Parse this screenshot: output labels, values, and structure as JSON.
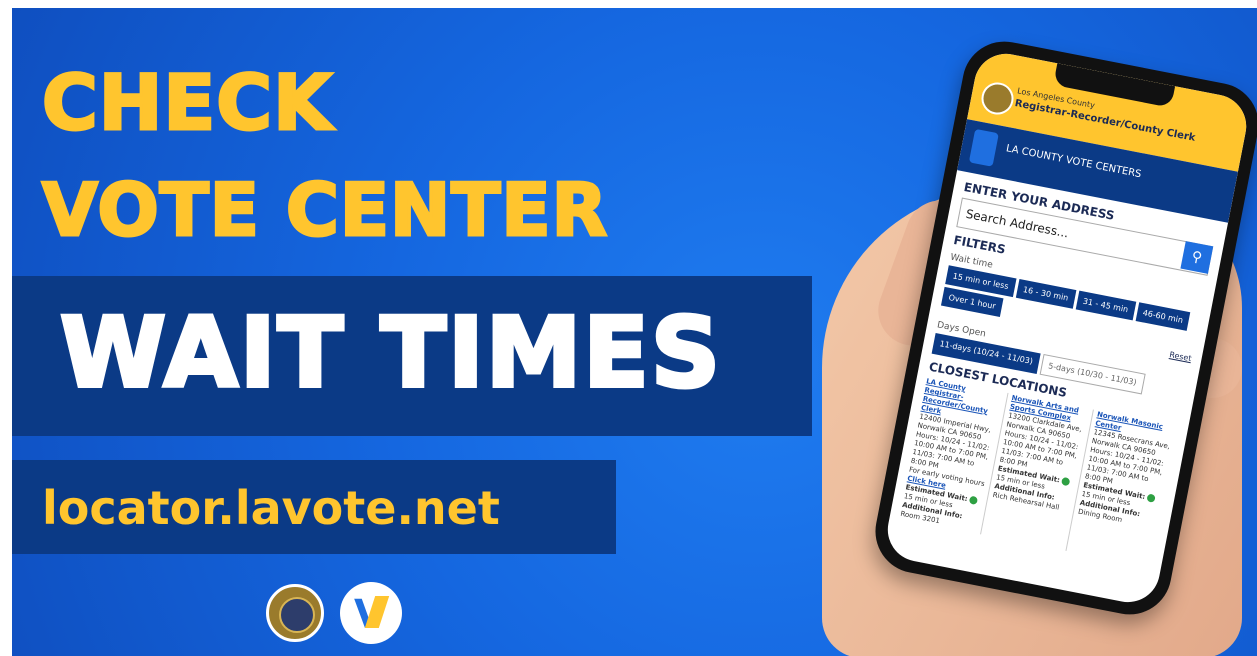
{
  "headline": {
    "line1": "CHECK",
    "line2": "VOTE CENTER",
    "line3": "WAIT TIMES",
    "url": "locator.lavote.net"
  },
  "colors": {
    "background": "#1567e0",
    "navy_band": "#0b3a86",
    "accent_yellow": "#ffc52e",
    "white": "#ffffff"
  },
  "logos": {
    "seal": "county-seal-icon",
    "vote_logo": "v-logo-icon"
  },
  "phone": {
    "header_line1": "Los Angeles County",
    "header_line2": "Registrar-Recorder/County Clerk",
    "nav_title": "LA COUNTY VOTE CENTERS",
    "enter_address": "ENTER YOUR ADDRESS",
    "search_placeholder": "Search Address...",
    "filters_title": "FILTERS",
    "wait_time_label": "Wait time",
    "wait_chips": [
      "15 min or less",
      "16 - 30 min",
      "31 - 45 min",
      "46-60 min",
      "Over 1 hour"
    ],
    "reset": "Reset",
    "days_open_label": "Days Open",
    "days_chips": [
      "11-days (10/24 - 11/03)",
      "5-days (10/30 - 11/03)"
    ],
    "closest_title": "CLOSEST LOCATIONS",
    "locations": [
      {
        "name": "LA County Registrar-Recorder/County Clerk",
        "address": "12400 Imperial Hwy, Norwalk CA 90650",
        "hours": "Hours: 10/24 - 11/02: 10:00 AM to 7:00 PM, 11/03: 7:00 AM to 8:00 PM",
        "extra": "For early voting hours",
        "link": "Click here",
        "wait_label": "Estimated Wait:",
        "wait": "15 min or less",
        "info_label": "Additional Info:",
        "info": "Room 3201"
      },
      {
        "name": "Norwalk Arts and Sports Complex",
        "address": "13200 Clarkdale Ave, Norwalk CA 90650",
        "hours": "Hours: 10/24 - 11/02: 10:00 AM to 7:00 PM, 11/03: 7:00 AM to 8:00 PM",
        "wait_label": "Estimated Wait:",
        "wait": "15 min or less",
        "info_label": "Additional Info:",
        "info": "Rich Rehearsal Hall"
      },
      {
        "name": "Norwalk Masonic Center",
        "address": "12345 Rosecrans Ave, Norwalk CA 90650",
        "hours": "Hours: 10/24 - 11/02: 10:00 AM to 7:00 PM, 11/03: 7:00 AM to 8:00 PM",
        "wait_label": "Estimated Wait:",
        "wait": "15 min or less",
        "info_label": "Additional Info:",
        "info": "Dining Room"
      }
    ]
  }
}
